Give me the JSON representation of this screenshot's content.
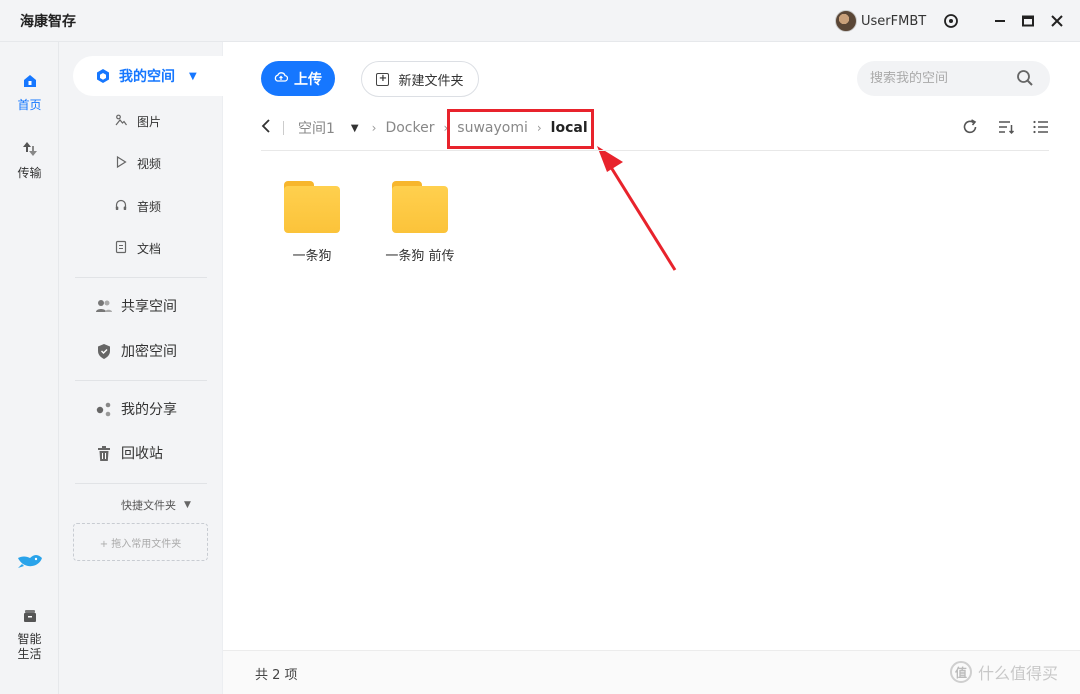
{
  "window": {
    "title": "海康智存",
    "user_name": "UserFMBT"
  },
  "rail": {
    "items": [
      {
        "label": "首页"
      },
      {
        "label": "传输"
      },
      {
        "label": "智能\n生活"
      }
    ],
    "smart_line1": "智能",
    "smart_line2": "生活"
  },
  "nav": {
    "my_space": "我的空间",
    "subs": [
      "图片",
      "视频",
      "音频",
      "文档"
    ],
    "shared": "共享空间",
    "encrypted": "加密空间",
    "my_share": "我的分享",
    "recycle": "回收站",
    "quick_folders": "快捷文件夹",
    "drag_hint": "+ 拖入常用文件夹"
  },
  "toolbar": {
    "upload": "上传",
    "new_folder": "新建文件夹",
    "search_placeholder": "搜索我的空间"
  },
  "breadcrumb": {
    "items": [
      "空间1",
      "Docker",
      "suwayomi",
      "local"
    ]
  },
  "files": [
    {
      "name": "一条狗"
    },
    {
      "name": "一条狗 前传"
    }
  ],
  "footer": {
    "count_text": "共 2 项"
  },
  "watermark": {
    "badge": "值",
    "text": "什么值得买"
  },
  "colors": {
    "accent": "#1677ff",
    "annotation": "#e8232c",
    "folder": "#fbc33a"
  }
}
